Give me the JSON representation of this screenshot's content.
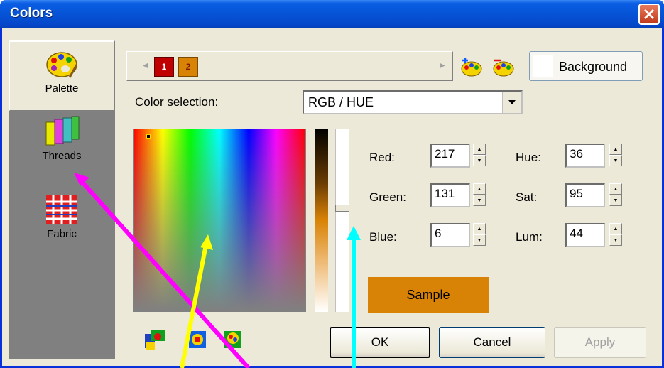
{
  "window": {
    "title": "Colors"
  },
  "nav": {
    "items": [
      {
        "label": "Palette"
      },
      {
        "label": "Threads"
      },
      {
        "label": "Fabric"
      }
    ]
  },
  "palette_tabs": [
    {
      "label": "1",
      "color": "#c00000"
    },
    {
      "label": "2",
      "color": "#d98306"
    }
  ],
  "toolbar": {
    "background_label": "Background"
  },
  "color_selection": {
    "label": "Color selection:",
    "value": "RGB / HUE"
  },
  "fields": {
    "red": {
      "label": "Red:",
      "value": "217"
    },
    "green": {
      "label": "Green:",
      "value": "131"
    },
    "blue": {
      "label": "Blue:",
      "value": "6"
    },
    "hue": {
      "label": "Hue:",
      "value": "36"
    },
    "sat": {
      "label": "Sat:",
      "value": "95"
    },
    "lum": {
      "label": "Lum:",
      "value": "44"
    }
  },
  "sample": {
    "label": "Sample",
    "color": "#d98306"
  },
  "buttons": {
    "ok": "OK",
    "cancel": "Cancel",
    "apply": "Apply"
  },
  "colors": {
    "titlebar": "#0653d6",
    "dialog": "#ece9d8",
    "panel": "#808080",
    "annotation_magenta": "#ff00ff",
    "annotation_yellow": "#ffff00",
    "annotation_cyan": "#00ffff"
  }
}
